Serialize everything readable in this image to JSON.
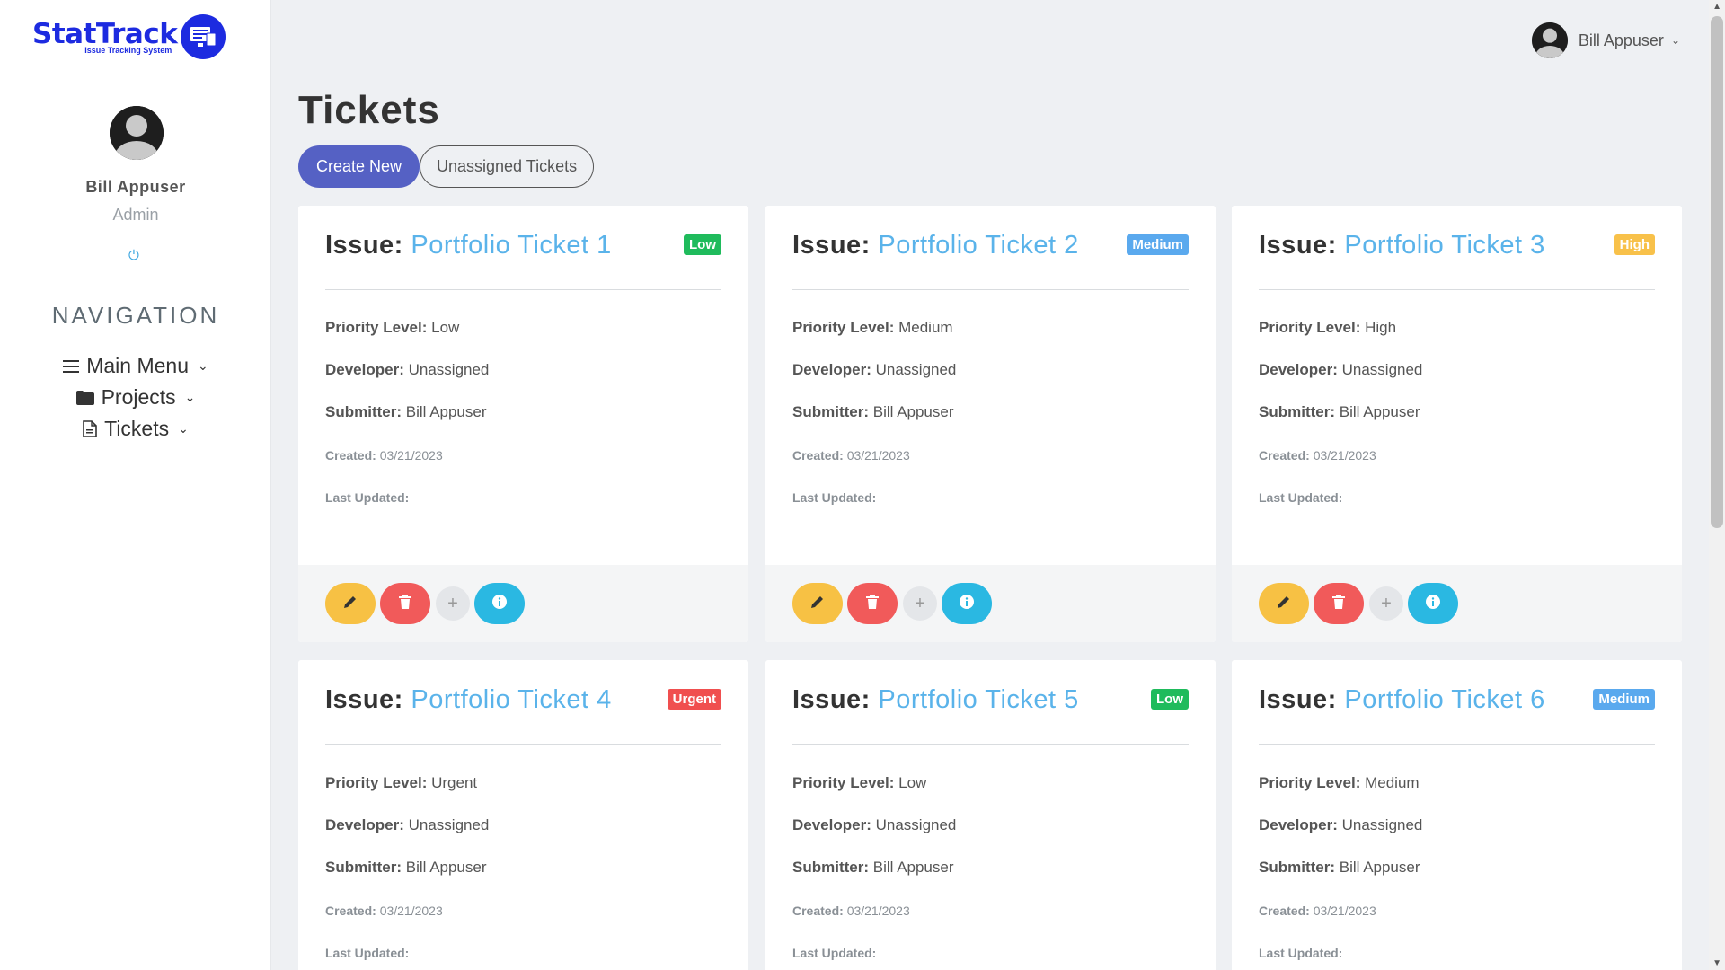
{
  "sidebar": {
    "logo_word": "StatTrack",
    "logo_subtitle": "Issue Tracking System",
    "user_name": "Bill Appuser",
    "user_role": "Admin",
    "nav_title": "NAVIGATION",
    "nav_items": [
      {
        "label": "Main Menu",
        "icon": "hamburger-icon"
      },
      {
        "label": "Projects",
        "icon": "folder-icon"
      },
      {
        "label": "Tickets",
        "icon": "document-icon"
      }
    ]
  },
  "header": {
    "user_name": "Bill Appuser"
  },
  "page": {
    "title": "Tickets",
    "create_label": "Create New",
    "unassigned_label": "Unassigned Tickets"
  },
  "labels": {
    "issue": "Issue:",
    "priority": "Priority Level:",
    "developer": "Developer:",
    "submitter": "Submitter:",
    "created": "Created:",
    "updated": "Last Updated:"
  },
  "colors": {
    "accent": "#5561c4",
    "link": "#5ab3ea",
    "badge_low": "#1fbb5c",
    "badge_medium": "#5aa9ee",
    "badge_high": "#f8c14a",
    "badge_urgent": "#f04f4f",
    "edit": "#f7c144",
    "delete": "#f15a5a",
    "info": "#2ab8e2"
  },
  "tickets": [
    {
      "title": "Portfolio Ticket 1",
      "badge": "Low",
      "priority": "Low",
      "developer": "Unassigned",
      "submitter": "Bill Appuser",
      "created": "03/21/2023",
      "updated": ""
    },
    {
      "title": "Portfolio Ticket 2",
      "badge": "Medium",
      "priority": "Medium",
      "developer": "Unassigned",
      "submitter": "Bill Appuser",
      "created": "03/21/2023",
      "updated": ""
    },
    {
      "title": "Portfolio Ticket 3",
      "badge": "High",
      "priority": "High",
      "developer": "Unassigned",
      "submitter": "Bill Appuser",
      "created": "03/21/2023",
      "updated": ""
    },
    {
      "title": "Portfolio Ticket 4",
      "badge": "Urgent",
      "priority": "Urgent",
      "developer": "Unassigned",
      "submitter": "Bill Appuser",
      "created": "03/21/2023",
      "updated": ""
    },
    {
      "title": "Portfolio Ticket 5",
      "badge": "Low",
      "priority": "Low",
      "developer": "Unassigned",
      "submitter": "Bill Appuser",
      "created": "03/21/2023",
      "updated": ""
    },
    {
      "title": "Portfolio Ticket 6",
      "badge": "Medium",
      "priority": "Medium",
      "developer": "Unassigned",
      "submitter": "Bill Appuser",
      "created": "03/21/2023",
      "updated": ""
    }
  ]
}
